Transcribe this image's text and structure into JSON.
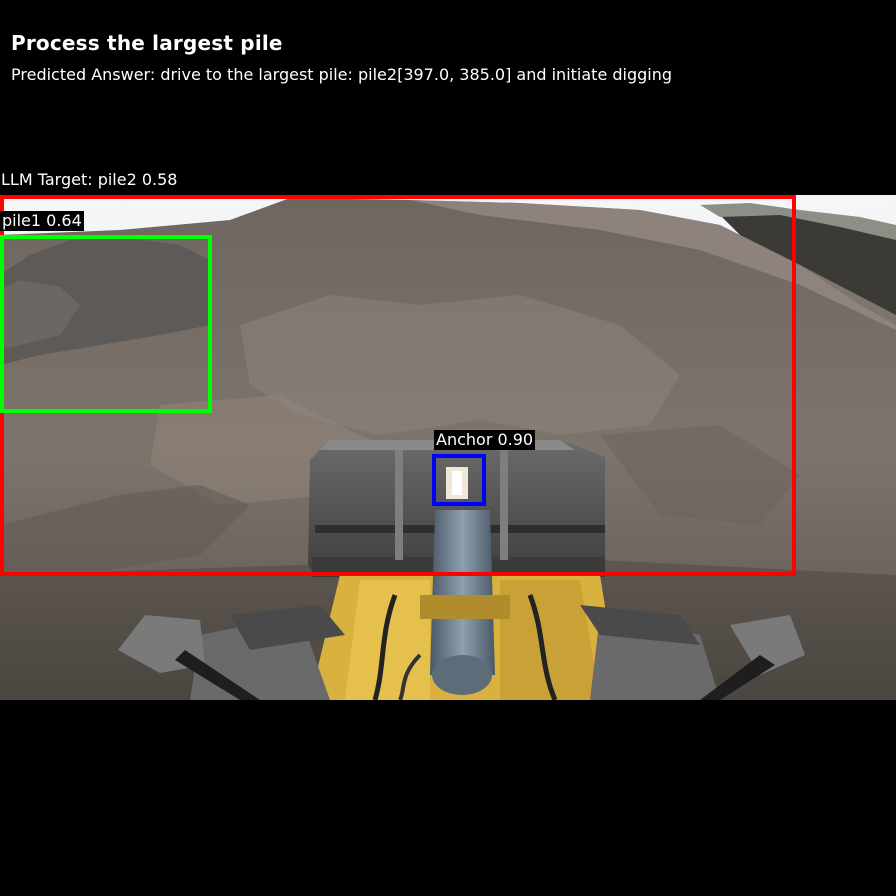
{
  "header": {
    "title": "Process the largest pile",
    "predicted_answer": "Predicted Answer: drive to the largest pile: pile2[397.0, 385.0] and initiate digging"
  },
  "detections": {
    "llm_target": {
      "label": "LLM Target: pile2 0.58",
      "color": "#ff0000"
    },
    "pile1": {
      "label": "pile1 0.64",
      "color": "#00ff00"
    },
    "anchor": {
      "label": "Anchor 0.90",
      "color": "#0000ff"
    }
  },
  "scene": {
    "description_icon": "wheel-loader-bucket-view"
  }
}
